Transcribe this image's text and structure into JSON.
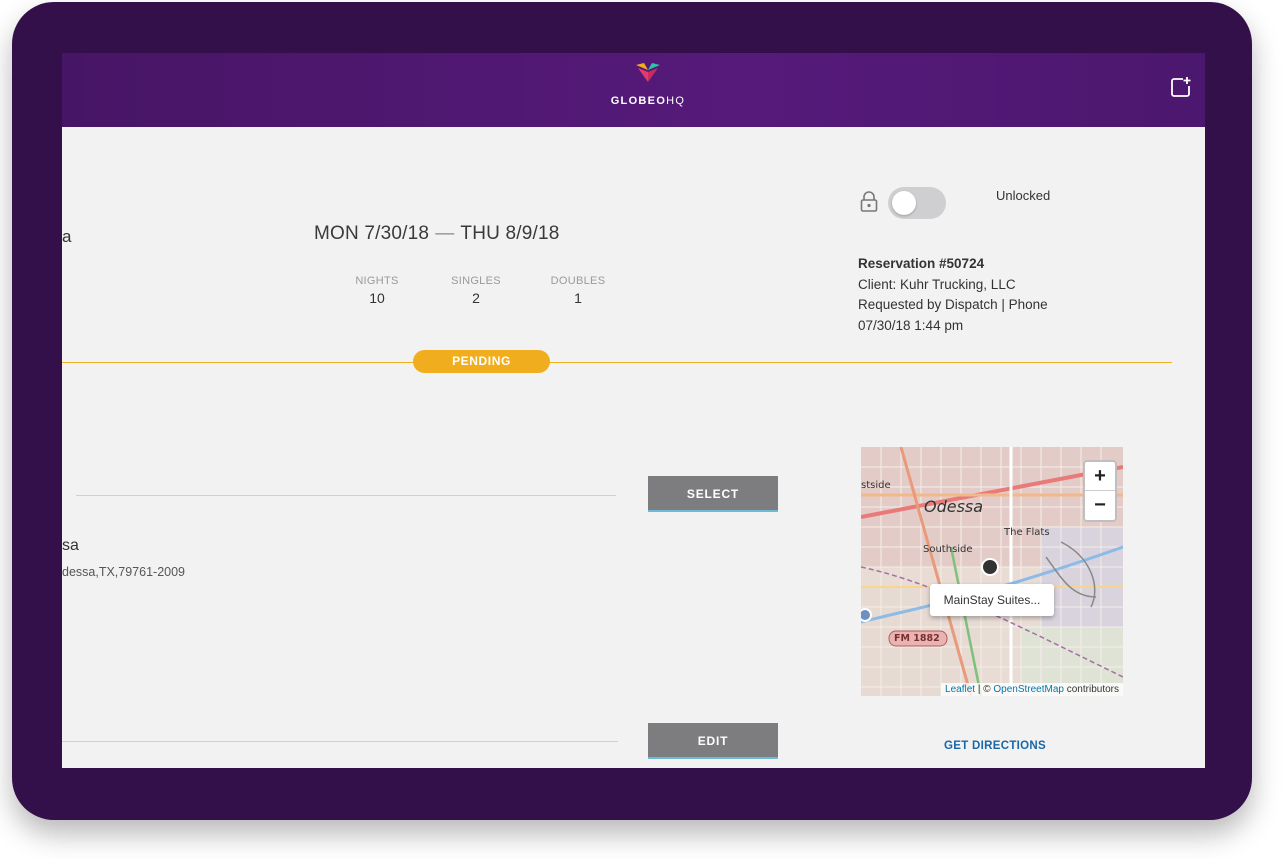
{
  "header": {
    "brand_bold": "GLOBEO",
    "brand_light": "HQ",
    "add_icon": "calendar-plus-icon"
  },
  "reservation": {
    "partial_name": "a",
    "dates": {
      "start": "MON 7/30/18",
      "separator": "—",
      "end": "THU 8/9/18"
    },
    "stats": [
      {
        "label": "NIGHTS",
        "value": "10"
      },
      {
        "label": "SINGLES",
        "value": "2"
      },
      {
        "label": "DOUBLES",
        "value": "1"
      }
    ],
    "lock": {
      "icon": "lock-icon",
      "status": "Unlocked",
      "toggle_on": false
    },
    "info": {
      "number": "Reservation #50724",
      "client": "Client: Kuhr Trucking, LLC",
      "requested": "Requested by Dispatch | Phone",
      "timestamp": "07/30/18 1:44 pm"
    },
    "status_badge": "PENDING",
    "status_color": "#f0ae1e"
  },
  "hotel": {
    "name_partial": "sa",
    "address_partial": "dessa,TX,79761-2009",
    "select_label": "SELECT",
    "edit_label": "EDIT"
  },
  "map": {
    "labels": {
      "city": "Odessa",
      "west": "stside",
      "southside": "Southside",
      "flats": "The Flats",
      "road": "FM 1882"
    },
    "zoom_in": "+",
    "zoom_out": "−",
    "popup": "MainStay Suites...",
    "attribution": {
      "leaflet": "Leaflet",
      "sep": " | © ",
      "osm": "OpenStreetMap",
      "tail": " contributors"
    },
    "directions_label": "GET DIRECTIONS"
  },
  "colors": {
    "header_purple": "#561a7a",
    "frame": "#33104a",
    "accent_gold": "#f0ae1e",
    "button_gray": "#7d7d80",
    "link_blue": "#1a67a8"
  }
}
